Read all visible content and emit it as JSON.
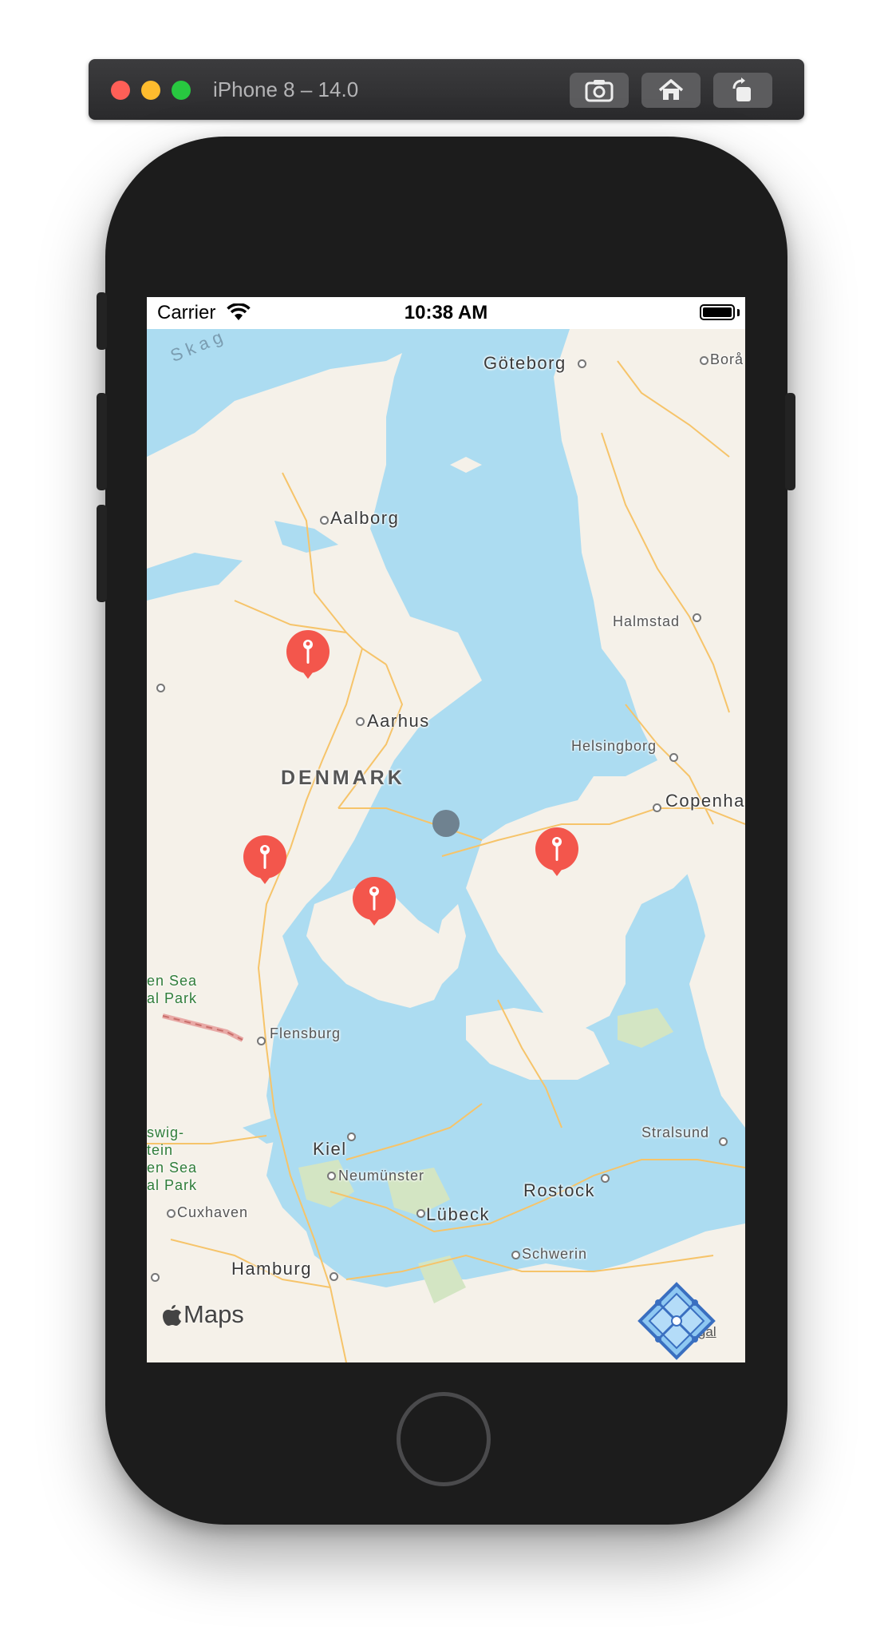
{
  "simulator": {
    "title": "iPhone 8 – 14.0",
    "buttons": [
      "screenshot-button",
      "home-button",
      "rotate-button"
    ]
  },
  "status_bar": {
    "carrier": "Carrier",
    "time": "10:38 AM"
  },
  "map": {
    "water_label": "Skag",
    "country_label": "DENMARK",
    "city_labels": {
      "goteborg": "Göteborg",
      "bora": "Borå",
      "aalborg": "Aalborg",
      "halmstad": "Halmstad",
      "aarhus": "Aarhus",
      "helsingborg": "Helsingborg",
      "copenhagen": "Copenha",
      "flensburg": "Flensburg",
      "kiel": "Kiel",
      "neumunster": "Neumünster",
      "rostock": "Rostock",
      "stralsund": "Stralsund",
      "lubeck": "Lübeck",
      "cuxhaven": "Cuxhaven",
      "schwerin": "Schwerin",
      "hamburg": "Hamburg"
    },
    "park_labels": {
      "wadden_line1": "en Sea",
      "wadden_line2": "al Park",
      "schleswig_line1": "swig-",
      "schleswig_line2": "tein",
      "schleswig_line3": "en Sea",
      "schleswig_line4": "al Park"
    },
    "pins_count": 4,
    "brand": "Maps",
    "legal": "Legal"
  },
  "colors": {
    "water": "#acdcf1",
    "land": "#f5f1e9",
    "pin": "#f3564c",
    "user_location": "#6f8290"
  },
  "icons": {
    "user_location": "current-location-icon",
    "pin": "map-pin-icon",
    "app": "xcode-instruments-icon"
  }
}
